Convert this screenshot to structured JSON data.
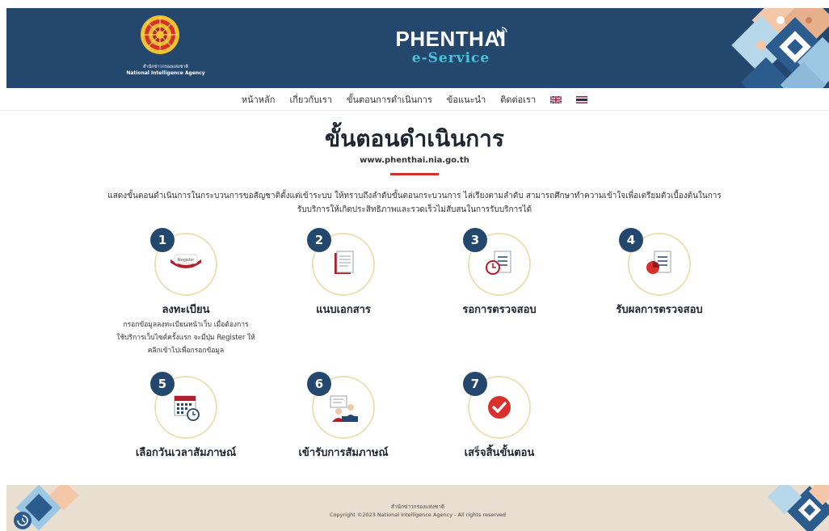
{
  "header": {
    "agency_name_th": "สำนักข่าวกรองแห่งชาติ",
    "agency_name_en": "National Intelligence Agency",
    "brand_title": "PHENTHAI",
    "brand_subtitle": "e-Service",
    "background_color": "#24476e"
  },
  "nav": {
    "items": [
      {
        "label": "หน้าหลัก"
      },
      {
        "label": "เกี่ยวกับเรา"
      },
      {
        "label": "ขั้นตอนการดำเนินการ"
      },
      {
        "label": "ข้อแนะนำ"
      },
      {
        "label": "ติดต่อเรา"
      }
    ],
    "flags": [
      "english-flag-icon",
      "thai-flag-icon"
    ]
  },
  "main": {
    "title": "ขั้นตอนดำเนินการ",
    "url": "www.phenthai.nia.go.th",
    "intro": "แสดงขั้นตอนดำเนินการในกระบวนการขอสัญชาติตั้งแต่เข้าระบบ ให้ทราบถึงลำดับขั้นตอนกระบวนการ ไล่เรียงตามลำดับ สามารถศึกษาทำความเข้าใจเพื่อเตรียมตัวเบื้องต้นในการรับบริการให้เกิดประสิทธิภาพและรวดเร็วไม่สับสนในการรับบริการได้",
    "steps": [
      {
        "number": "1",
        "label": "ลงทะเบียน",
        "icon": "register-button-icon",
        "register_text": "Register",
        "desc": [
          "กรอกข้อมูลลงทะเบียนหน้าเว็บ เมื่อต้องการ",
          "ใช้บริการเว็บไซต์ครั้งแรก จะมีปุ่ม Register ให้",
          "คลิกเข้าไปเพื่อกรอกข้อมูล"
        ]
      },
      {
        "number": "2",
        "label": "แนบเอกสาร",
        "icon": "document-icon"
      },
      {
        "number": "3",
        "label": "รอการตรวจสอบ",
        "icon": "document-clock-icon"
      },
      {
        "number": "4",
        "label": "รับผลการตรวจสอบ",
        "icon": "document-result-icon"
      },
      {
        "number": "5",
        "label": "เลือกวันเวลาสัมภาษณ์",
        "icon": "calendar-clock-icon"
      },
      {
        "number": "6",
        "label": "เข้ารับการสัมภาษณ์",
        "icon": "interview-icon"
      },
      {
        "number": "7",
        "label": "เสร็จสิ้นขั้นตอน",
        "icon": "check-circle-icon"
      }
    ]
  },
  "footer": {
    "agency_name_th": "สำนักข่าวกรองแห่งชาติ",
    "copyright": "Copyright ©2023 National Intelligence Agency - All rights reserved"
  },
  "colors": {
    "primary": "#24476e",
    "accent_red": "#d32f2f",
    "circle_border": "#ece0b5",
    "footer_bg": "#e9dfd1"
  }
}
